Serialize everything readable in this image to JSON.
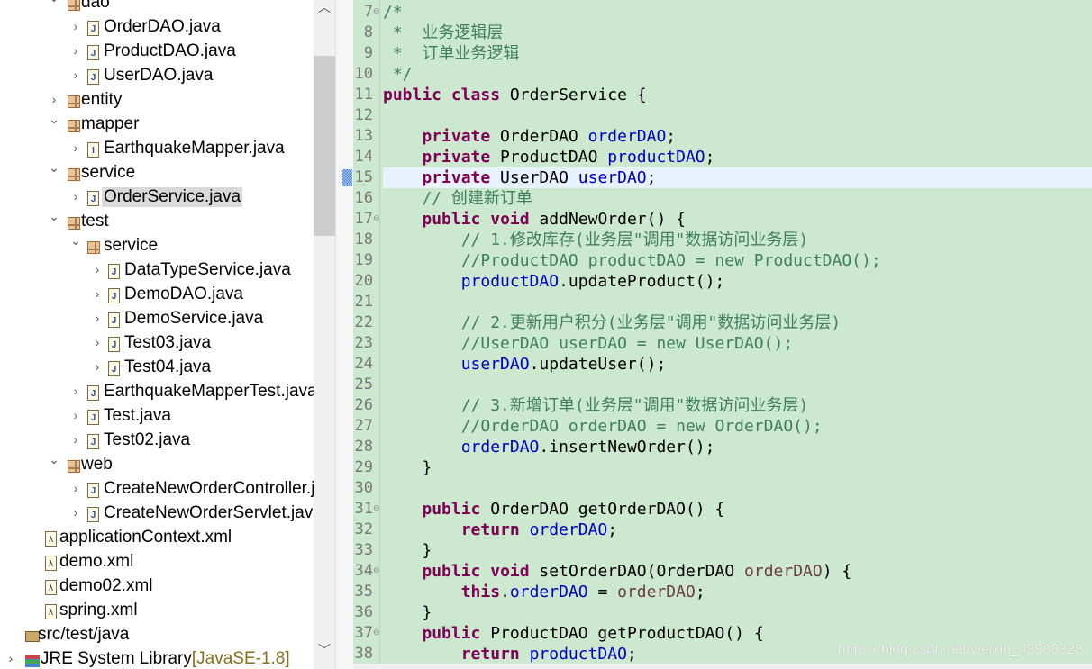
{
  "tree": [
    {
      "label": "dao",
      "icon": "package",
      "level": 1,
      "expanded": true
    },
    {
      "label": "OrderDAO.java",
      "icon": "java-file",
      "level": 2
    },
    {
      "label": "ProductDAO.java",
      "icon": "java-file",
      "level": 2
    },
    {
      "label": "UserDAO.java",
      "icon": "java-file",
      "level": 2
    },
    {
      "label": "entity",
      "icon": "package",
      "level": 1,
      "expanded": false
    },
    {
      "label": "mapper",
      "icon": "package-warning",
      "level": 1,
      "expanded": true
    },
    {
      "label": "EarthquakeMapper.java",
      "icon": "java-interface-warning",
      "level": 2
    },
    {
      "label": "service",
      "icon": "package",
      "level": 1,
      "expanded": true
    },
    {
      "label": "OrderService.java",
      "icon": "java-file",
      "level": 2,
      "selected": true
    },
    {
      "label": "test",
      "icon": "package-warning",
      "level": 1,
      "expanded": true
    },
    {
      "label": "service",
      "icon": "package-warning",
      "level": 2,
      "expanded": true
    },
    {
      "label": "DataTypeService.java",
      "icon": "java-file",
      "level": 3
    },
    {
      "label": "DemoDAO.java",
      "icon": "java-file",
      "level": 3
    },
    {
      "label": "DemoService.java",
      "icon": "java-file",
      "level": 3
    },
    {
      "label": "Test03.java",
      "icon": "java-file-warning",
      "level": 3
    },
    {
      "label": "Test04.java",
      "icon": "java-file-warning",
      "level": 3
    },
    {
      "label": "EarthquakeMapperTest.java",
      "icon": "java-file-warning",
      "level": 2
    },
    {
      "label": "Test.java",
      "icon": "java-file-warning",
      "level": 2
    },
    {
      "label": "Test02.java",
      "icon": "java-file-warning",
      "level": 2
    },
    {
      "label": "web",
      "icon": "package",
      "level": 1,
      "expanded": true
    },
    {
      "label": "CreateNewOrderController.java",
      "icon": "java-file",
      "level": 2
    },
    {
      "label": "CreateNewOrderServlet.java",
      "icon": "java-file",
      "level": 2
    },
    {
      "label": "applicationContext.xml",
      "icon": "spring-xml-warning",
      "level": 0
    },
    {
      "label": "demo.xml",
      "icon": "spring-xml",
      "level": 0
    },
    {
      "label": "demo02.xml",
      "icon": "spring-xml",
      "level": 0
    },
    {
      "label": "spring.xml",
      "icon": "spring-xml",
      "level": 0
    },
    {
      "label": "src/test/java",
      "icon": "source-folder",
      "level": -1
    },
    {
      "label": "JRE System Library",
      "extra": "[JavaSE-1.8]",
      "icon": "library",
      "level": -2
    }
  ],
  "code": [
    {
      "n": "7",
      "fold": true,
      "t": [
        [
          "cm",
          "/*"
        ]
      ]
    },
    {
      "n": "8",
      "t": [
        [
          "cm",
          " *  业务逻辑层"
        ]
      ]
    },
    {
      "n": "9",
      "t": [
        [
          "cm",
          " *  订单业务逻辑"
        ]
      ]
    },
    {
      "n": "10",
      "t": [
        [
          "cm",
          " */"
        ]
      ]
    },
    {
      "n": "11",
      "t": [
        [
          "kw",
          "public"
        ],
        [
          "",
          "",
          " "
        ],
        [
          "kw",
          "class"
        ],
        [
          "",
          " OrderService {"
        ]
      ]
    },
    {
      "n": "12",
      "t": []
    },
    {
      "n": "13",
      "t": [
        [
          "",
          "    "
        ],
        [
          "kw",
          "private"
        ],
        [
          "",
          " OrderDAO "
        ],
        [
          "fd",
          "orderDAO"
        ],
        [
          "",
          ";"
        ]
      ]
    },
    {
      "n": "14",
      "t": [
        [
          "",
          "    "
        ],
        [
          "kw",
          "private"
        ],
        [
          "",
          " ProductDAO "
        ],
        [
          "fd",
          "productDAO"
        ],
        [
          "",
          ";"
        ]
      ]
    },
    {
      "n": "15",
      "current": true,
      "t": [
        [
          "",
          "    "
        ],
        [
          "kw",
          "private"
        ],
        [
          "",
          " UserDAO "
        ],
        [
          "fd",
          "userDAO"
        ],
        [
          "",
          ";"
        ]
      ]
    },
    {
      "n": "16",
      "t": [
        [
          "",
          "    "
        ],
        [
          "cm",
          "// 创建新订单"
        ]
      ]
    },
    {
      "n": "17",
      "fold": true,
      "t": [
        [
          "",
          "    "
        ],
        [
          "kw",
          "public"
        ],
        [
          "",
          " "
        ],
        [
          "kw",
          "void"
        ],
        [
          "",
          " addNewOrder() {"
        ]
      ]
    },
    {
      "n": "18",
      "t": [
        [
          "",
          "        "
        ],
        [
          "cm",
          "// 1.修改库存(业务层\"调用\"数据访问业务层)"
        ]
      ]
    },
    {
      "n": "19",
      "t": [
        [
          "",
          "        "
        ],
        [
          "cm",
          "//ProductDAO productDAO = new ProductDAO();"
        ]
      ]
    },
    {
      "n": "20",
      "t": [
        [
          "",
          "        "
        ],
        [
          "fd",
          "productDAO"
        ],
        [
          "",
          ".updateProduct();"
        ]
      ]
    },
    {
      "n": "21",
      "t": []
    },
    {
      "n": "22",
      "t": [
        [
          "",
          "        "
        ],
        [
          "cm",
          "// 2.更新用户积分(业务层\"调用\"数据访问业务层)"
        ]
      ]
    },
    {
      "n": "23",
      "t": [
        [
          "",
          "        "
        ],
        [
          "cm",
          "//UserDAO userDAO = new UserDAO();"
        ]
      ]
    },
    {
      "n": "24",
      "t": [
        [
          "",
          "        "
        ],
        [
          "fd",
          "userDAO"
        ],
        [
          "",
          ".updateUser();"
        ]
      ]
    },
    {
      "n": "25",
      "t": []
    },
    {
      "n": "26",
      "t": [
        [
          "",
          "        "
        ],
        [
          "cm",
          "// 3.新增订单(业务层\"调用\"数据访问业务层)"
        ]
      ]
    },
    {
      "n": "27",
      "t": [
        [
          "",
          "        "
        ],
        [
          "cm",
          "//OrderDAO orderDAO = new OrderDAO();"
        ]
      ]
    },
    {
      "n": "28",
      "t": [
        [
          "",
          "        "
        ],
        [
          "fd",
          "orderDAO"
        ],
        [
          "",
          ".insertNewOrder();"
        ]
      ]
    },
    {
      "n": "29",
      "t": [
        [
          "",
          "    }"
        ]
      ]
    },
    {
      "n": "30",
      "t": []
    },
    {
      "n": "31",
      "fold": true,
      "t": [
        [
          "",
          "    "
        ],
        [
          "kw",
          "public"
        ],
        [
          "",
          " OrderDAO getOrderDAO() {"
        ]
      ]
    },
    {
      "n": "32",
      "t": [
        [
          "",
          "        "
        ],
        [
          "kw",
          "return"
        ],
        [
          "",
          " "
        ],
        [
          "fd",
          "orderDAO"
        ],
        [
          "",
          ";"
        ]
      ]
    },
    {
      "n": "33",
      "t": [
        [
          "",
          "    }"
        ]
      ]
    },
    {
      "n": "34",
      "fold": true,
      "t": [
        [
          "",
          "    "
        ],
        [
          "kw",
          "public"
        ],
        [
          "",
          " "
        ],
        [
          "kw",
          "void"
        ],
        [
          "",
          " setOrderDAO(OrderDAO "
        ],
        [
          "pm",
          "orderDAO"
        ],
        [
          "",
          ") {"
        ]
      ]
    },
    {
      "n": "35",
      "t": [
        [
          "",
          "        "
        ],
        [
          "kw",
          "this"
        ],
        [
          "",
          "."
        ],
        [
          "fd",
          "orderDAO"
        ],
        [
          "",
          " = "
        ],
        [
          "pm",
          "orderDAO"
        ],
        [
          "",
          ";"
        ]
      ]
    },
    {
      "n": "36",
      "t": [
        [
          "",
          "    }"
        ]
      ]
    },
    {
      "n": "37",
      "fold": true,
      "t": [
        [
          "",
          "    "
        ],
        [
          "kw",
          "public"
        ],
        [
          "",
          " ProductDAO getProductDAO() {"
        ]
      ]
    },
    {
      "n": "38",
      "t": [
        [
          "",
          "        "
        ],
        [
          "kw",
          "return"
        ],
        [
          "",
          " "
        ],
        [
          "fd",
          "productDAO"
        ],
        [
          "",
          ";"
        ]
      ]
    }
  ],
  "watermark": "https://blog.csdn.net/weixin_43908328",
  "colors": {
    "editor_bg": "#cce8cf",
    "keyword": "#7f0055",
    "field": "#0000c0",
    "comment": "#3f7f5f",
    "parameter": "#6a3e3e",
    "current_line": "#e8f2fe"
  }
}
